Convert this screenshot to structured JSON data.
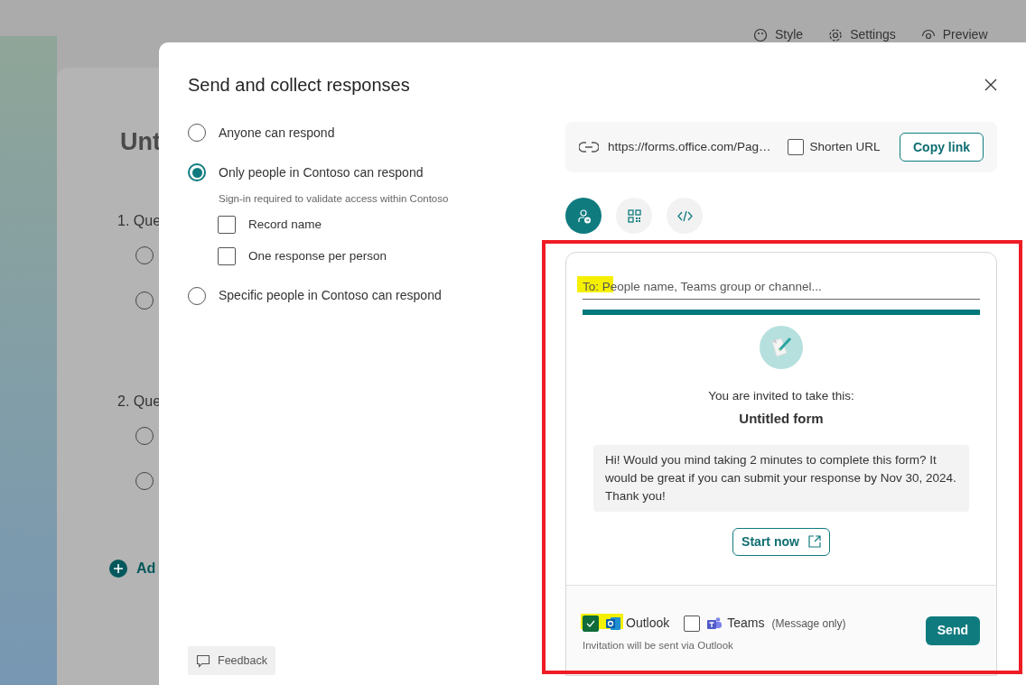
{
  "background": {
    "toolbar": [
      {
        "kind": "style",
        "label": "Style"
      },
      {
        "kind": "settings",
        "label": "Settings"
      },
      {
        "kind": "preview",
        "label": "Preview"
      }
    ],
    "form_title": "Unt",
    "questions": [
      {
        "label": "1. Que",
        "choices": [
          {
            "selected": false
          },
          {
            "selected": false
          }
        ]
      },
      {
        "label": "2. Que",
        "choices": [
          {
            "selected": false
          },
          {
            "selected": false
          }
        ]
      }
    ],
    "add_label": "Ad"
  },
  "dialog": {
    "title": "Send and collect responses",
    "access_options": [
      {
        "label": "Anyone can respond",
        "selected": false
      },
      {
        "label": "Only people in Contoso can respond",
        "selected": true,
        "note": "Sign-in required to validate access within Contoso",
        "sub_options": [
          {
            "label": "Record name",
            "checked": false
          },
          {
            "label": "One response per person",
            "checked": false
          }
        ]
      },
      {
        "label": "Specific people in Contoso can respond",
        "selected": false
      }
    ],
    "link": {
      "url": "https://forms.office.com/Pag…",
      "shorten": {
        "label": "Shorten URL",
        "checked": false
      },
      "copy_button": "Copy link"
    },
    "share_modes": [
      {
        "kind": "invite",
        "selected": true
      },
      {
        "kind": "qr",
        "selected": false
      },
      {
        "kind": "embed",
        "selected": false
      }
    ],
    "invite": {
      "placeholder": "To: People name, Teams group or channel...",
      "invited_line": "You are invited to take this:",
      "form_name": "Untitled form",
      "message": "Hi! Would you mind taking 2 minutes to complete this form? It would be great if you can submit your response by Nov 30, 2024. Thank you!",
      "start_button": "Start now",
      "channels": [
        {
          "kind": "outlook",
          "label": "Outlook",
          "checked": true
        },
        {
          "kind": "teams",
          "label": "Teams",
          "note": "(Message only)",
          "checked": false
        }
      ],
      "hint": "Invitation will be sent via Outlook",
      "send_button": "Send"
    },
    "feedback_button": "Feedback"
  },
  "annotations": [
    {
      "kind": "frame"
    },
    {
      "kind": "field-highlight"
    },
    {
      "kind": "checkbox-highlight"
    }
  ]
}
